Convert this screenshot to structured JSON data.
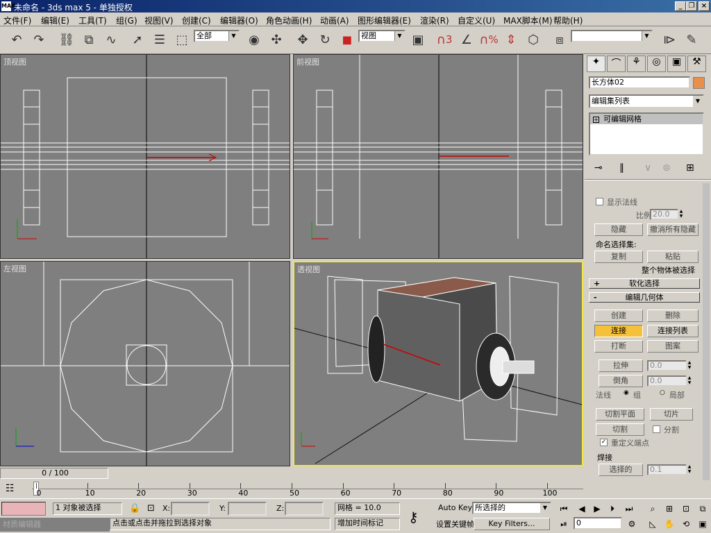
{
  "window": {
    "title": "未命名 - 3ds max 5 - 单独授权",
    "app_icon": "MAX",
    "buttons": [
      "_",
      "❐",
      "×"
    ]
  },
  "menu": [
    "文件(F)",
    "编辑(E)",
    "工具(T)",
    "组(G)",
    "视图(V)",
    "创建(C)",
    "编辑器(O)",
    "角色动画(H)",
    "动画(A)",
    "图形编辑器(E)",
    "渲染(R)",
    "自定义(U)",
    "MAX脚本(M)",
    "帮助(H)"
  ],
  "toolbar": {
    "selection_filter": "全部",
    "coord_system": "视图",
    "named_selection": "",
    "icons": [
      "undo-icon",
      "redo-icon",
      "select-link-icon",
      "unlink-icon",
      "bind-space-warp-icon",
      "select-icon",
      "select-by-name-icon",
      "rect-region-icon",
      "select-move-icon",
      "select-rotate-icon",
      "select-scale-icon",
      "pivot-icon",
      "snap-3d-icon",
      "angle-snap-icon",
      "percent-snap-icon",
      "spinner-snap-icon",
      "named-sel-icon",
      "mirror-icon",
      "align-icon"
    ],
    "snap_label": "3",
    "pct_label": "%"
  },
  "viewports": {
    "top": {
      "label": "顶视图"
    },
    "front": {
      "label": "前视图"
    },
    "left": {
      "label": "左视图"
    },
    "persp": {
      "label": "透视图"
    }
  },
  "command_panel": {
    "tabs": [
      "create-tab-icon",
      "modify-tab-icon",
      "hierarchy-tab-icon",
      "motion-tab-icon",
      "display-tab-icon",
      "utilities-tab-icon"
    ],
    "object_name": "长方体02",
    "object_color": "#e8904a",
    "modifier_list": "编辑集列表",
    "stack_item": "可编辑网格",
    "show_normals": "显示法线",
    "scale_label": "比例:",
    "scale_value": "20.0",
    "hide": "隐藏",
    "unhide_all": "撤消所有隐藏",
    "named_sel": "命名选择集:",
    "copy": "复制",
    "paste": "粘贴",
    "whole_selected": "整个物体被选择",
    "soft_sel": "软化选择",
    "edit_geom": "编辑几何体",
    "create": "创建",
    "delete": "删除",
    "attach": "连接",
    "attach_list": "连接列表",
    "break": "打断",
    "detach": "图案",
    "extrude": "拉伸",
    "extrude_val": "0.0",
    "chamfer": "倒角",
    "chamfer_val": "0.0",
    "normal": "法线",
    "group": "组",
    "local": "局部",
    "slice_plane": "切割平面",
    "slice": "切片",
    "cut": "切割",
    "split": "分割",
    "refine_ends": "重定义端点",
    "weld": "焊接",
    "selected": "选择的",
    "weld_val": "0.1"
  },
  "timeline": {
    "frame": "0 / 100",
    "ticks": [
      "0",
      "10",
      "20",
      "30",
      "40",
      "50",
      "60",
      "70",
      "80",
      "90",
      "100"
    ]
  },
  "status": {
    "selected": "1 对象被选择",
    "x_label": "X:",
    "y_label": "Y:",
    "z_label": "Z:",
    "grid": "网格 = 10.0",
    "prompt": "点击或点击并拖拉到选择对象",
    "add_time_tag": "增加时间标记",
    "auto_key": "Auto Key",
    "set_key": "设置关键帧",
    "key_mode": "所选择的",
    "key_filters": "Key Filters...",
    "frame_field": "0",
    "mat_editor": "材质编辑器"
  }
}
